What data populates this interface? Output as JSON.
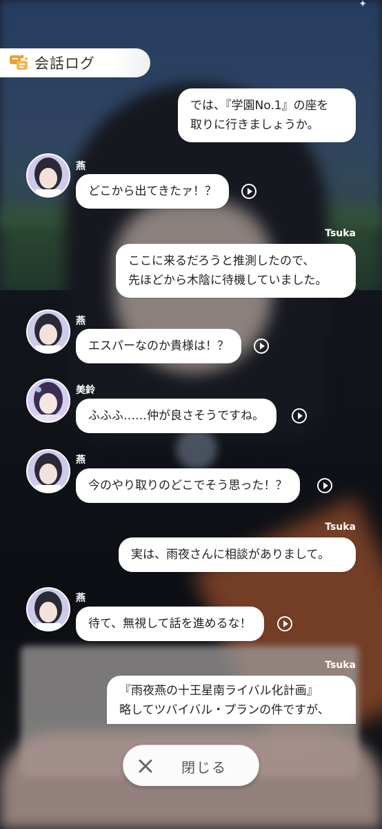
{
  "header": {
    "title": "会話ログ"
  },
  "messages": [
    {
      "side": "right",
      "speaker": "",
      "lines": [
        "では、『学園No.1』の座を",
        "取りに行きましょうか。"
      ]
    },
    {
      "side": "left",
      "speaker": "燕",
      "text": "どこから出てきたァ！？"
    },
    {
      "side": "right",
      "speaker": "Tsuka",
      "lines": [
        "ここに来るだろうと推測したので、",
        "先ほどから木陰に待機していました。"
      ]
    },
    {
      "side": "left",
      "speaker": "燕",
      "text": "エスパーなのか貴様は！？"
    },
    {
      "side": "left",
      "speaker": "美鈴",
      "text": "ふふふ……仲が良さそうですね。"
    },
    {
      "side": "left",
      "speaker": "燕",
      "text": "今のやり取りのどこでそう思った！？"
    },
    {
      "side": "right",
      "speaker": "Tsuka",
      "lines": [
        "実は、雨夜さんに相談がありまして。"
      ]
    },
    {
      "side": "left",
      "speaker": "燕",
      "text": "待て、無視して話を進めるな！"
    },
    {
      "side": "right",
      "speaker": "Tsuka",
      "lines": [
        "『雨夜燕の十王星南ライバル化計画』",
        "略してツバイバル・プランの件ですが、"
      ]
    }
  ],
  "close_button": {
    "label": "閉じる"
  },
  "colors": {
    "bubble": "#ffffff",
    "logo": "#f0a030",
    "avatar_bg": "#cdc8e8"
  },
  "icons": {
    "header": "chat-log-icon",
    "play": "play-voice-icon",
    "close": "close-icon"
  }
}
